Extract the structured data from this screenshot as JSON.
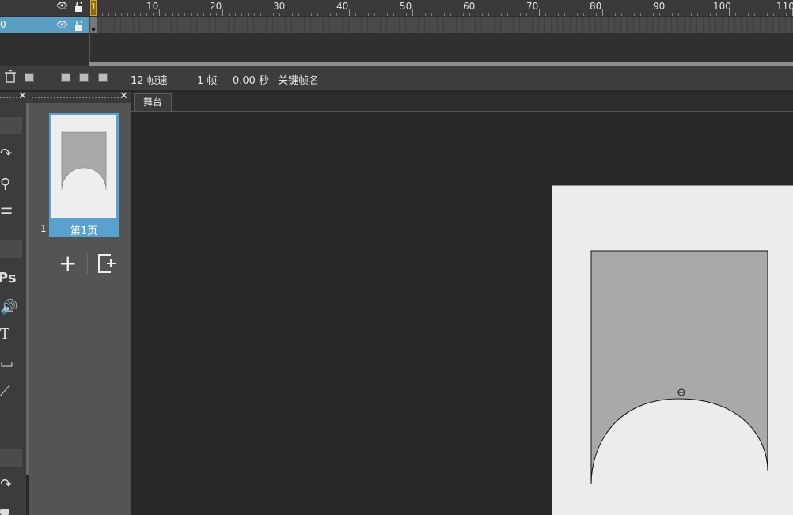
{
  "timeline": {
    "ruler_labels": [
      "10",
      "20",
      "30",
      "40",
      "50",
      "60",
      "70",
      "80",
      "90",
      "100",
      "110"
    ],
    "current_frame_marker": "1",
    "layer_name": "0",
    "eye_icon": "eye-icon",
    "lock_icon": "lock-icon"
  },
  "toolbar": {
    "fps": "12 帧速",
    "frame": "1 帧",
    "time": "0.00 秒",
    "keyframe_name_label": "关键帧名"
  },
  "tools": {
    "ps_label": "Ps",
    "text_tool": "T"
  },
  "pages": {
    "thumb_label": "第1页",
    "page_number": "1",
    "add_label": "+",
    "add_page_icon": "add-page-icon"
  },
  "stage": {
    "tab_label": "舞台"
  },
  "colors": {
    "accent": "#5aa2ce",
    "layer_selected": "#5a9ec4",
    "playhead": "#d8a32a",
    "canvas": "#ececec",
    "shape_fill": "#a9a9a9"
  }
}
